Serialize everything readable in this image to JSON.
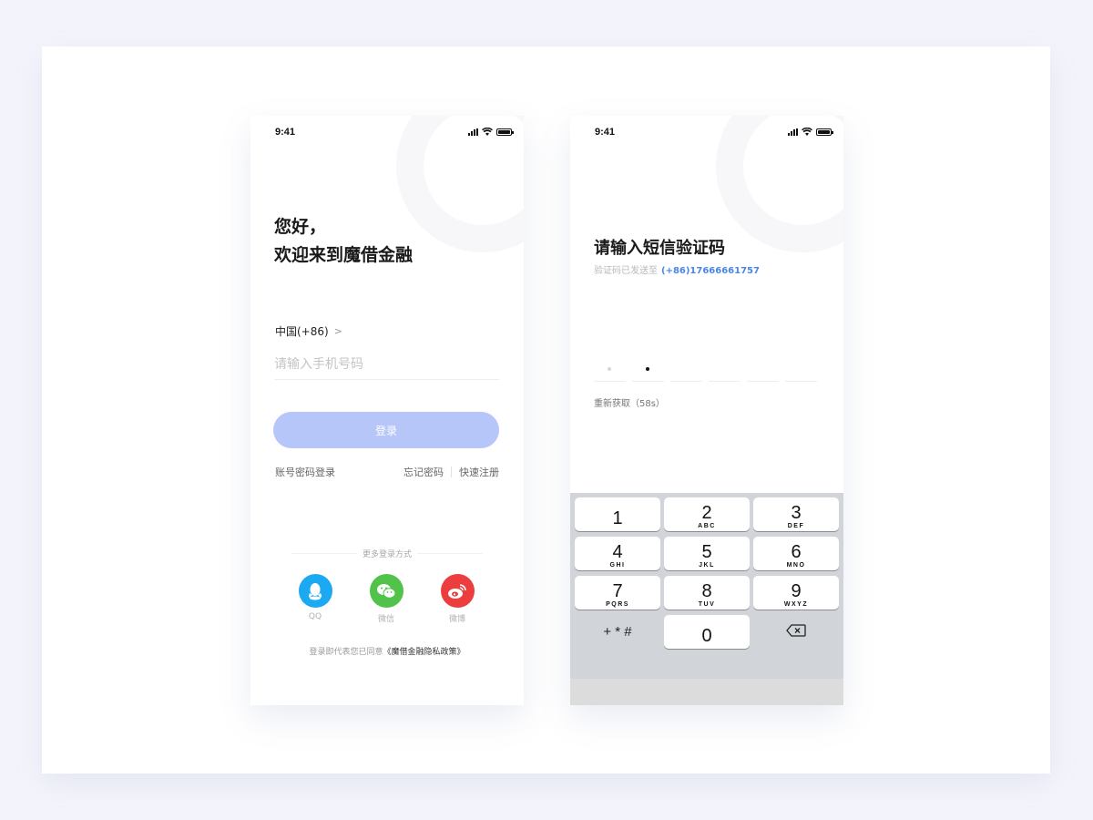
{
  "login_screen": {
    "status_time": "9:41",
    "greeting_line1": "您好，",
    "greeting_line2": "欢迎来到魔借金融",
    "country_code": "中国(+86)",
    "phone_placeholder": "请输入手机号码",
    "login_button": "登录",
    "password_login": "账号密码登录",
    "forgot_password": "忘记密码",
    "quick_register": "快速注册",
    "more_login": "更多登录方式",
    "social": [
      {
        "label": "QQ",
        "color": "#1ba9f2",
        "icon": "qq-icon"
      },
      {
        "label": "微信",
        "color": "#51c24a",
        "icon": "wechat-icon"
      },
      {
        "label": "微博",
        "color": "#ec3e3e",
        "icon": "weibo-icon"
      }
    ],
    "agreement_prefix": "登录即代表您已同意",
    "agreement_link": "《魔借金融隐私政策》",
    "colors": {
      "primary_button_disabled": "#b6c6f8"
    }
  },
  "verify_screen": {
    "status_time": "9:41",
    "title": "请输入短信验证码",
    "subtitle_prefix": "验证码已发送至",
    "phone_number": "(+86)17666661757",
    "code_slots_filled": 2,
    "code_slots_total": 6,
    "resend": "重新获取（58s）",
    "colors": {
      "accent": "#4a86e8"
    },
    "keypad": [
      {
        "digit": "1",
        "letters": ""
      },
      {
        "digit": "2",
        "letters": "ABC"
      },
      {
        "digit": "3",
        "letters": "DEF"
      },
      {
        "digit": "4",
        "letters": "GHI"
      },
      {
        "digit": "5",
        "letters": "JKL"
      },
      {
        "digit": "6",
        "letters": "MNO"
      },
      {
        "digit": "7",
        "letters": "PQRS"
      },
      {
        "digit": "8",
        "letters": "TUV"
      },
      {
        "digit": "9",
        "letters": "WXYZ"
      }
    ],
    "key_symbols": "+ * #",
    "key_zero": "0"
  }
}
